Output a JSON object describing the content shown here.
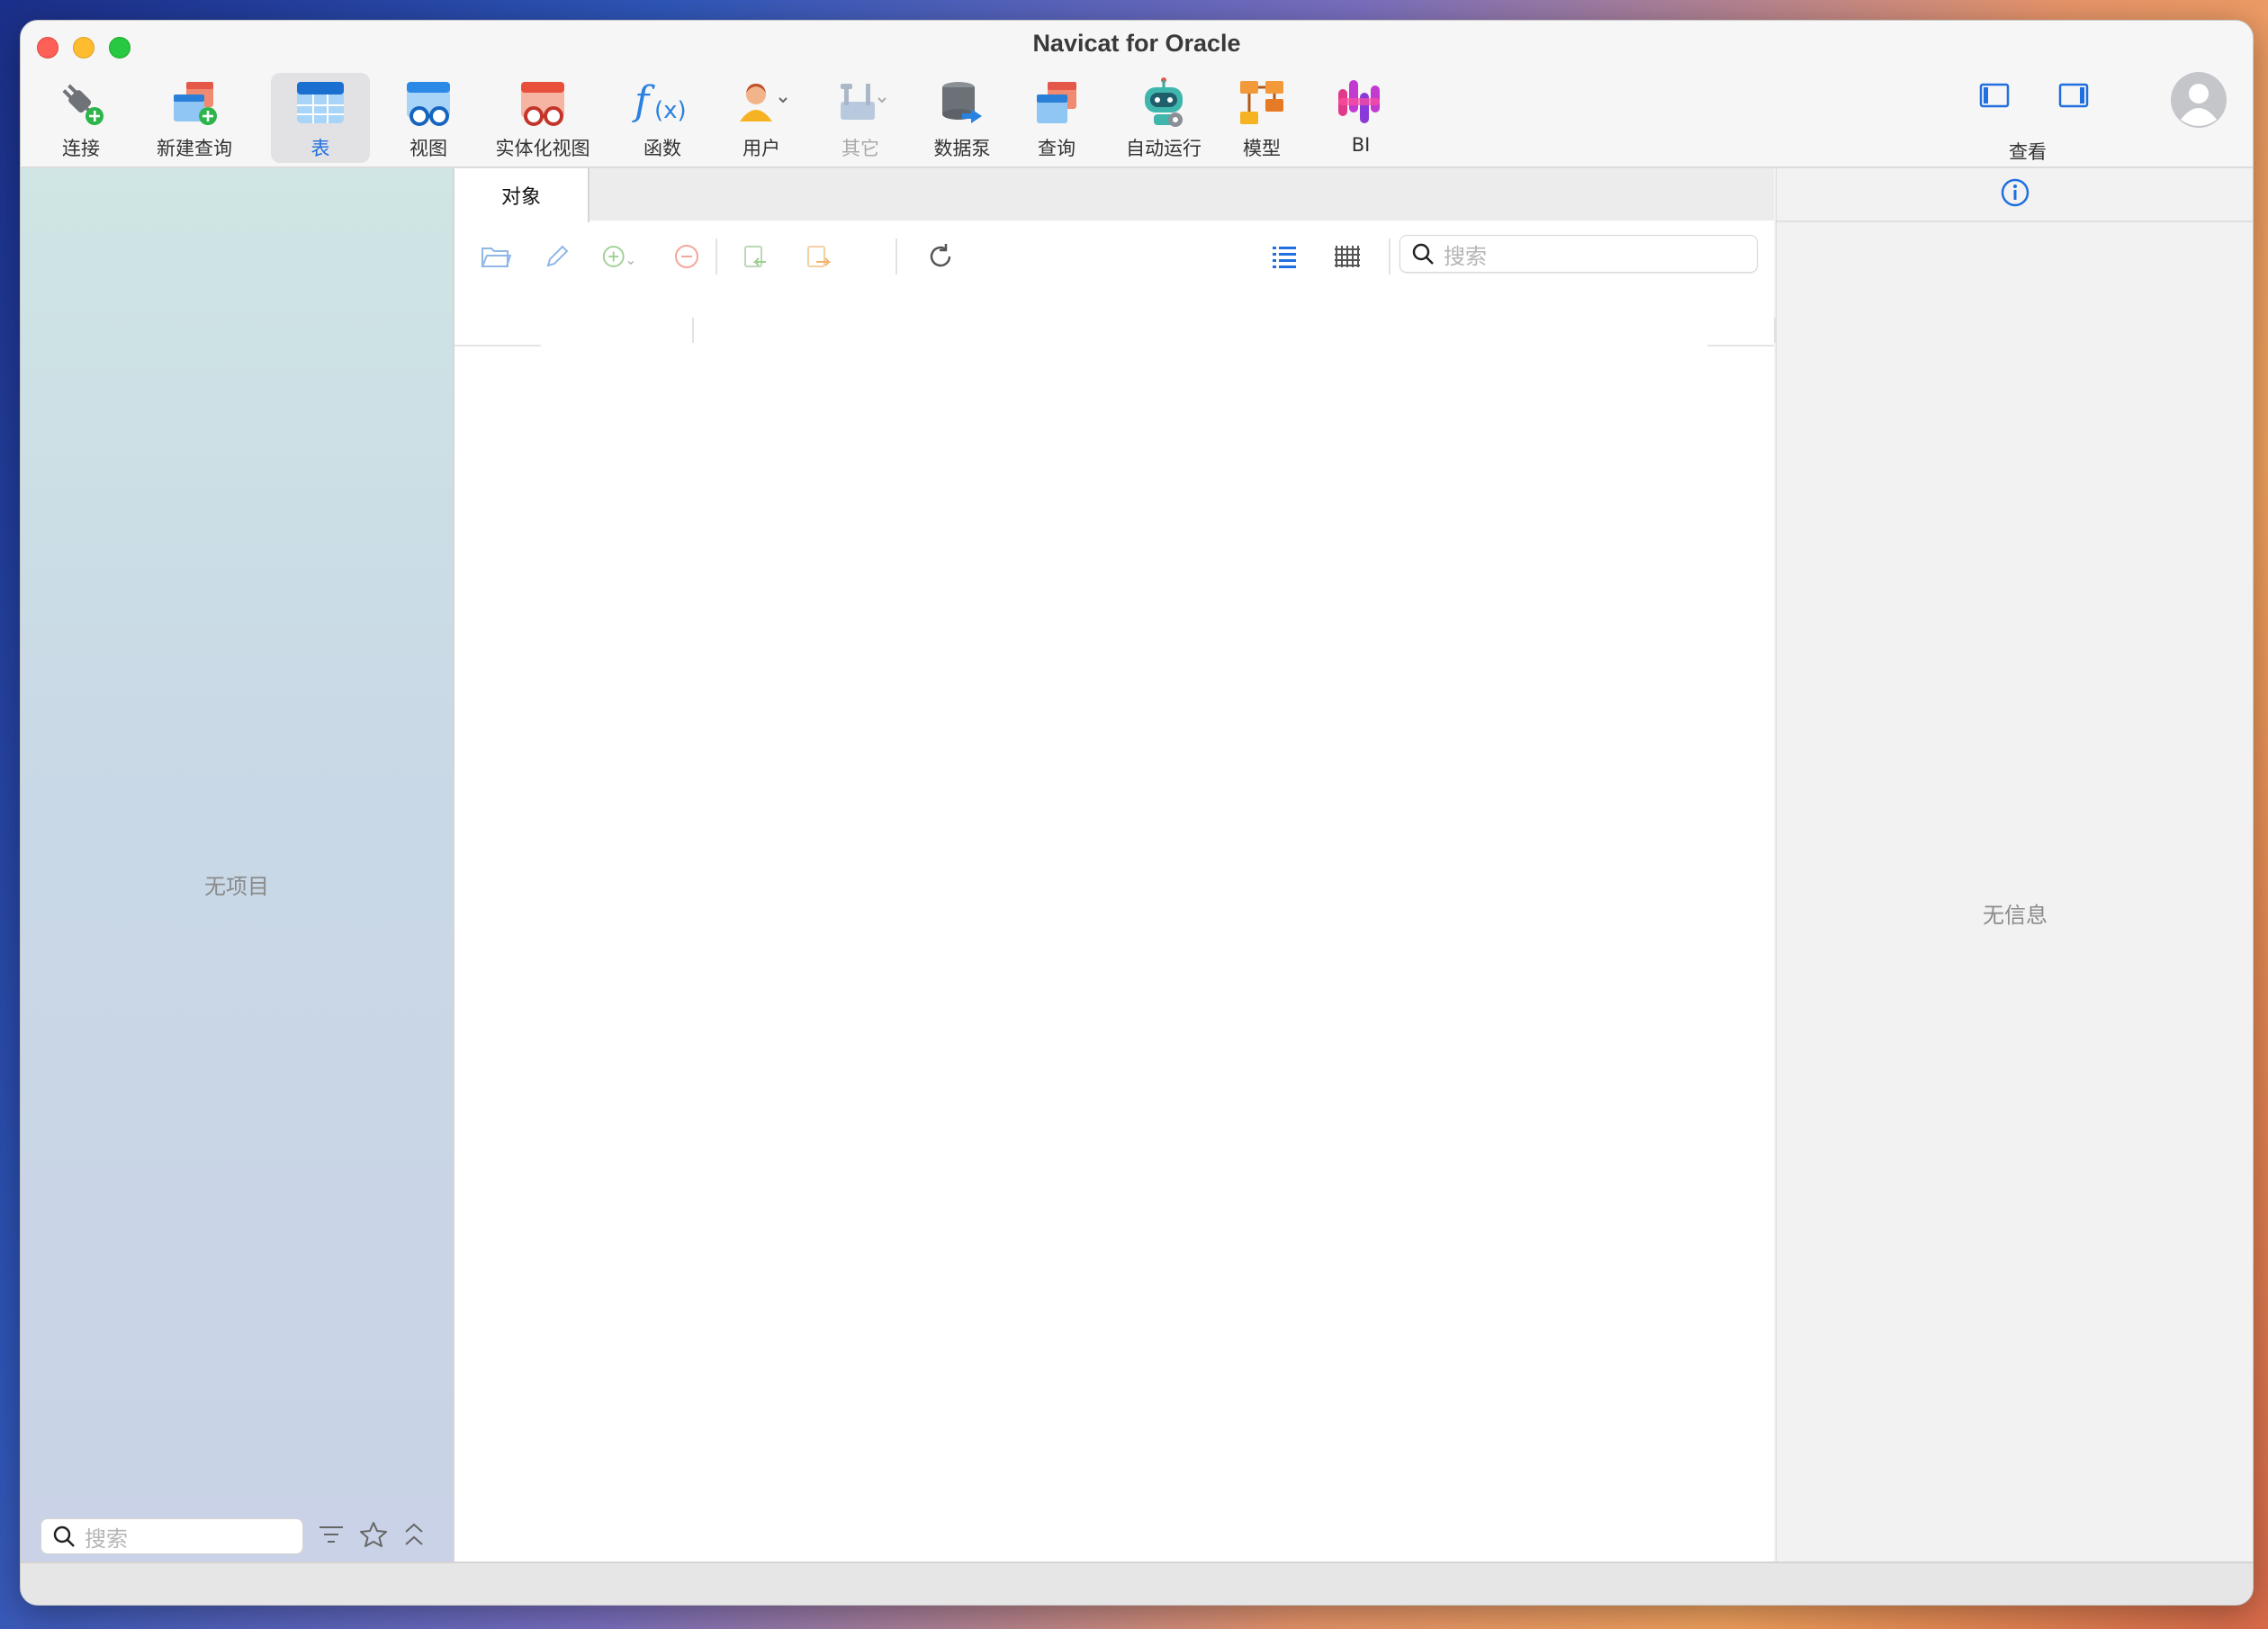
{
  "window": {
    "title": "Navicat for Oracle"
  },
  "toolbar": {
    "items": [
      {
        "label": "连接"
      },
      {
        "label": "新建查询"
      },
      {
        "label": "表"
      },
      {
        "label": "视图"
      },
      {
        "label": "实体化视图"
      },
      {
        "label": "函数"
      },
      {
        "label": "用户"
      },
      {
        "label": "其它"
      },
      {
        "label": "数据泵"
      },
      {
        "label": "查询"
      },
      {
        "label": "自动运行"
      },
      {
        "label": "模型"
      },
      {
        "label": "BI"
      }
    ],
    "view_label": "查看",
    "active_item": "表"
  },
  "sidebar": {
    "empty_message": "无项目",
    "search_placeholder": "搜索"
  },
  "main": {
    "tab_label": "对象",
    "search_placeholder": "搜索"
  },
  "info_panel": {
    "empty_message": "无信息"
  },
  "colors": {
    "accent": "#1f6fe0",
    "sidebar_top": "#cfe6e4",
    "sidebar_bottom": "#c9d2e6"
  }
}
